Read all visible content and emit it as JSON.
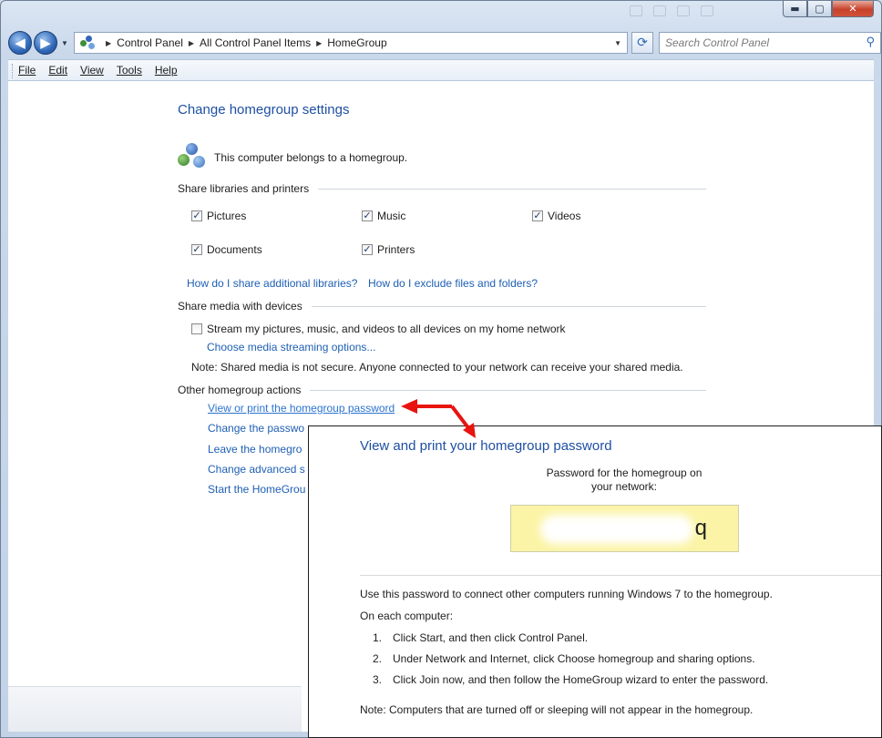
{
  "window": {
    "controls": {
      "minimize": "▬",
      "maximize": "▢",
      "close": "✕"
    }
  },
  "nav": {
    "back": "◀",
    "forward": "▶",
    "breadcrumb": [
      "Control Panel",
      "All Control Panel Items",
      "HomeGroup"
    ],
    "search_placeholder": "Search Control Panel"
  },
  "menu": [
    "File",
    "Edit",
    "View",
    "Tools",
    "Help"
  ],
  "main": {
    "title": "Change homegroup settings",
    "status": "This computer belongs to a homegroup.",
    "share_section": "Share libraries and printers",
    "libraries": [
      {
        "label": "Pictures",
        "checked": true
      },
      {
        "label": "Music",
        "checked": true
      },
      {
        "label": "Videos",
        "checked": true
      },
      {
        "label": "Documents",
        "checked": true
      },
      {
        "label": "Printers",
        "checked": true
      }
    ],
    "links_share": [
      "How do I share additional libraries?",
      "How do I exclude files and folders?"
    ],
    "media_section": "Share media with devices",
    "stream_label": "Stream my pictures, music, and videos to all devices on my home network",
    "stream_checked": false,
    "media_options_link": "Choose media streaming options...",
    "media_note": "Note: Shared media is not secure. Anyone connected to your network can receive your shared media.",
    "other_section": "Other homegroup actions",
    "actions": [
      "View or print the homegroup password",
      "Change the passwo",
      "Leave the homegro",
      "Change advanced s",
      "Start the HomeGrou"
    ]
  },
  "dialog": {
    "title": "View and print your homegroup password",
    "label_line1": "Password for the homegroup on",
    "label_line2": "your network:",
    "password_visible": "q",
    "intro": "Use this password to connect other computers running Windows 7 to the homegroup.",
    "on_each": "On each computer:",
    "steps": [
      {
        "n": "1.",
        "text": "Click Start, and then click Control Panel."
      },
      {
        "n": "2.",
        "text": "Under Network and Internet, click Choose homegroup and sharing options."
      },
      {
        "n": "3.",
        "text": "Click Join now, and then follow the HomeGroup wizard to enter the password."
      }
    ],
    "note": "Note: Computers that are turned off or sleeping will not appear in the homegroup."
  },
  "colors": {
    "link": "#1e5fb3",
    "heading": "#1e4fa3",
    "password_bg": "#fbf4a6",
    "arrow": "#e8140f"
  }
}
